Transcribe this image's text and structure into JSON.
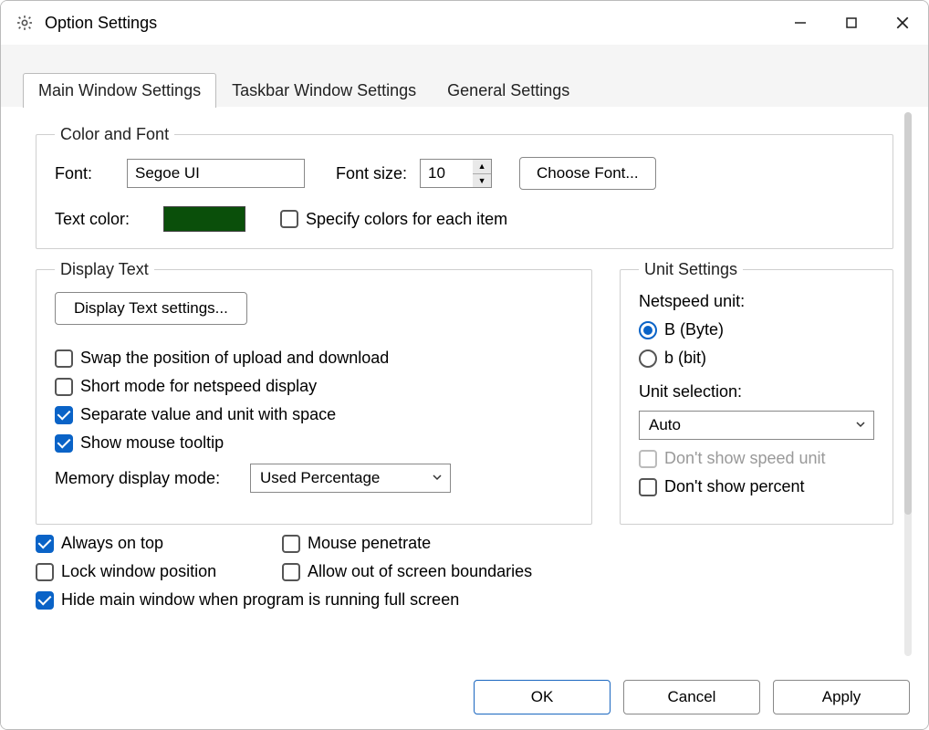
{
  "window": {
    "title": "Option Settings"
  },
  "tabs": {
    "main": "Main Window Settings",
    "taskbar": "Taskbar Window Settings",
    "general": "General Settings"
  },
  "colorFont": {
    "legend": "Color and Font",
    "fontLabel": "Font:",
    "fontValue": "Segoe UI",
    "fontSizeLabel": "Font size:",
    "fontSizeValue": "10",
    "chooseFont": "Choose Font...",
    "textColorLabel": "Text color:",
    "textColorHex": "#0a4f0a",
    "specifyColors": "Specify colors for each item"
  },
  "displayText": {
    "legend": "Display Text",
    "settingsBtn": "Display Text settings...",
    "swap": "Swap the position of upload and download",
    "shortMode": "Short mode for netspeed display",
    "separate": "Separate value and unit with space",
    "tooltip": "Show mouse tooltip",
    "memoryLabel": "Memory display mode:",
    "memoryValue": "Used Percentage"
  },
  "unitSettings": {
    "legend": "Unit Settings",
    "netspeedLabel": "Netspeed unit:",
    "optionByte": "B (Byte)",
    "optionBit": "b (bit)",
    "unitSelectionLabel": "Unit selection:",
    "unitSelectionValue": "Auto",
    "dontShowSpeed": "Don't show speed unit",
    "dontShowPercent": "Don't show percent"
  },
  "misc": {
    "alwaysOnTop": "Always on top",
    "mousePenetrate": "Mouse penetrate",
    "lockWindow": "Lock window position",
    "allowOut": "Allow out of screen boundaries",
    "hideFullscreen": "Hide main window when program is running full screen"
  },
  "buttons": {
    "ok": "OK",
    "cancel": "Cancel",
    "apply": "Apply"
  }
}
